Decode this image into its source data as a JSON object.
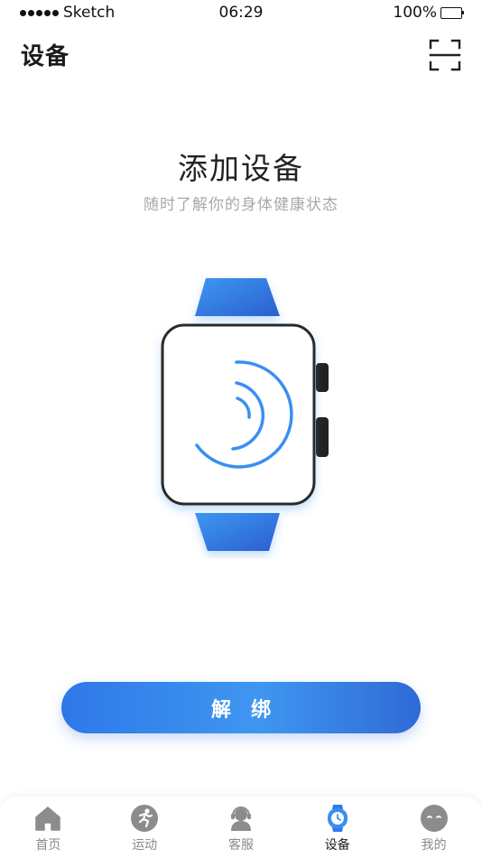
{
  "status_bar": {
    "carrier": "Sketch",
    "time": "06:29",
    "battery": "100%"
  },
  "header": {
    "title": "设备",
    "scan_icon": "scan-frame-icon"
  },
  "hero": {
    "title": "添加设备",
    "subtitle": "随时了解你的身体健康状态",
    "illustration_icon": "smartwatch-icon"
  },
  "unbind_button": {
    "label": "解 绑"
  },
  "tabbar": {
    "active_index": 3,
    "items": [
      {
        "label": "首页",
        "icon": "home-icon"
      },
      {
        "label": "运动",
        "icon": "running-icon"
      },
      {
        "label": "客服",
        "icon": "customer-service-icon"
      },
      {
        "label": "设备",
        "icon": "watch-icon"
      },
      {
        "label": "我的",
        "icon": "profile-face-icon"
      }
    ]
  },
  "colors": {
    "accent": "#3a8ff0",
    "accent_dark": "#2a63d4",
    "inactive_icon": "#8c8c8c",
    "subtitle": "#a8a8a8"
  }
}
